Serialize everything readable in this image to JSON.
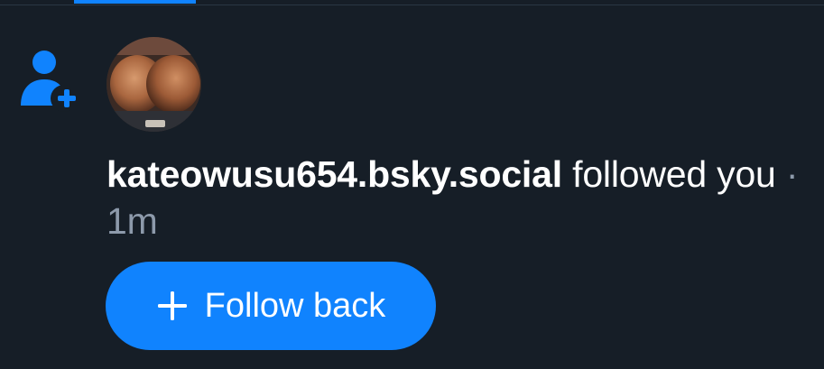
{
  "notification": {
    "icon": "person-plus-icon",
    "handle": "kateowusu654.bsky.social",
    "action_text": "followed you",
    "separator": "·",
    "time_ago": "1m",
    "button": {
      "icon": "plus-icon",
      "label": "Follow back"
    }
  },
  "colors": {
    "background": "#161e27",
    "accent": "#1083fe",
    "muted_text": "#8d9aab",
    "text": "#ffffff"
  }
}
